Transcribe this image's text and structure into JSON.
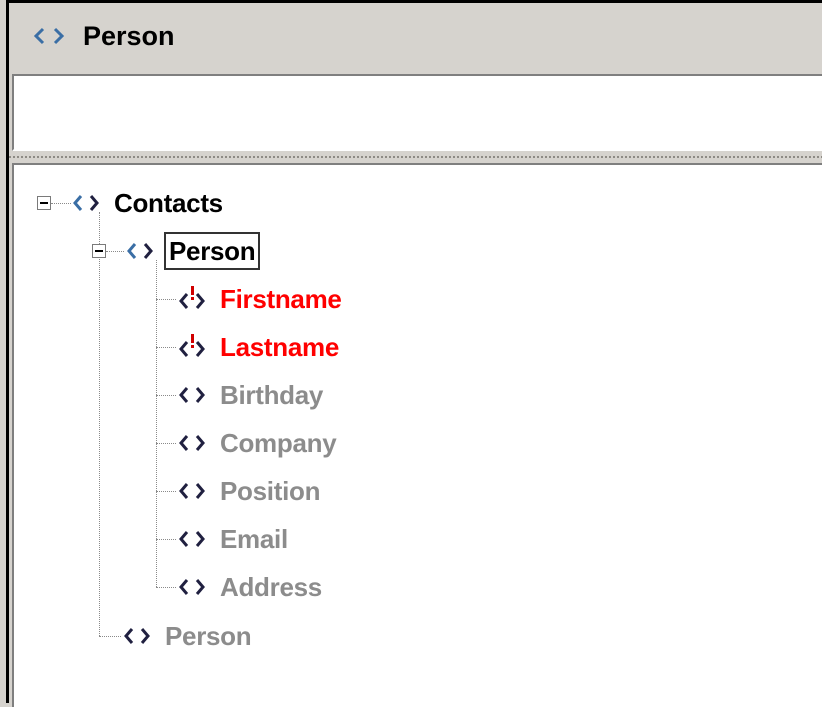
{
  "header": {
    "title": "Person",
    "icon": "element-brackets-icon"
  },
  "input": {
    "value": ""
  },
  "tree": {
    "root": {
      "label": "Contacts"
    },
    "selected": {
      "label": "Person"
    },
    "children": [
      {
        "label": "Firstname",
        "state": "required"
      },
      {
        "label": "Lastname",
        "state": "required"
      },
      {
        "label": "Birthday",
        "state": "optional"
      },
      {
        "label": "Company",
        "state": "optional"
      },
      {
        "label": "Position",
        "state": "optional"
      },
      {
        "label": "Email",
        "state": "optional"
      },
      {
        "label": "Address",
        "state": "optional"
      }
    ],
    "sibling": {
      "label": "Person",
      "state": "optional"
    }
  },
  "colors": {
    "required": "#ff0000",
    "optional": "#8c8c8c",
    "icon_blue": "#3a6ea5",
    "icon_dark": "#202040"
  }
}
